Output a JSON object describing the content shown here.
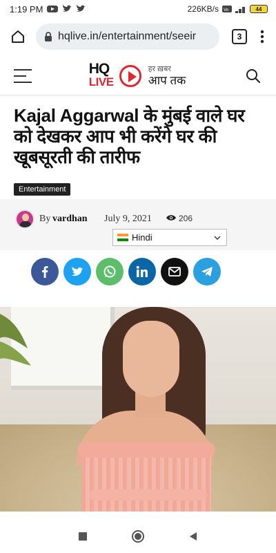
{
  "status_bar": {
    "time": "1:19 PM",
    "network_speed": "226KB/s",
    "battery": "44",
    "icons": [
      "play-icon",
      "mail-icon",
      "twitter-icon",
      "twitter-icon",
      "volte-icon",
      "signal-icon",
      "battery-icon"
    ]
  },
  "browser": {
    "url": "hqlive.in/entertainment/seeir",
    "tab_count": "3"
  },
  "site_header": {
    "logo_hq": "HQ",
    "logo_live": "LIVE",
    "tagline_small": "हर ख़बर",
    "tagline_big": "आप तक"
  },
  "article": {
    "title": "Kajal Aggarwal के मुंबई वाले घर को देखकर आप भी करेंगे घर की खूबसूरती की तारीफ",
    "category": "Entertainment",
    "author_prefix": "By",
    "author": "vardhan",
    "date": "July 9, 2021",
    "views": "206"
  },
  "language_select": {
    "selected": "Hindi"
  },
  "share": [
    {
      "name": "facebook",
      "color": "#3b5998",
      "glyph": "f"
    },
    {
      "name": "twitter",
      "color": "#1da1f2",
      "glyph": "t"
    },
    {
      "name": "whatsapp",
      "color": "#5cbe6a",
      "glyph": "w"
    },
    {
      "name": "linkedin",
      "color": "#0b66a8",
      "glyph": "in"
    },
    {
      "name": "email",
      "color": "#111111",
      "glyph": "✉"
    },
    {
      "name": "telegram",
      "color": "#2aa0e1",
      "glyph": "➤"
    }
  ],
  "colors": {
    "brand_red": "#e0262e",
    "badge_bg": "#222222"
  }
}
